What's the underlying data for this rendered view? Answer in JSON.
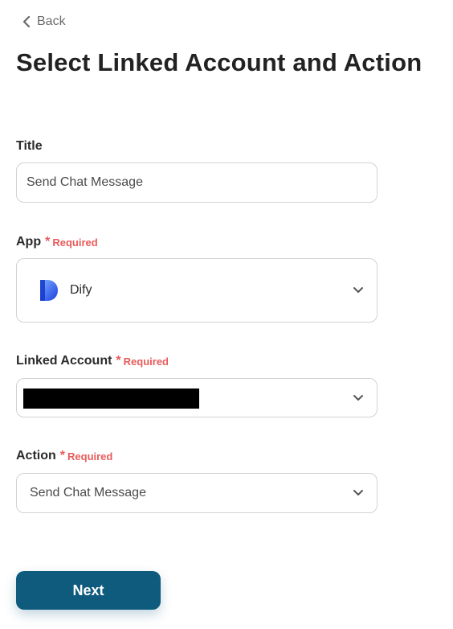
{
  "nav": {
    "back_label": "Back"
  },
  "page": {
    "title": "Select Linked Account and Action"
  },
  "title_field": {
    "label": "Title",
    "value": "Send Chat Message"
  },
  "app_field": {
    "label": "App",
    "required_mark": "*",
    "required_text": "Required",
    "selected_app": "Dify",
    "icon": "dify-logo-icon"
  },
  "linked_account_field": {
    "label": "Linked Account",
    "required_mark": "*",
    "required_text": "Required"
  },
  "action_field": {
    "label": "Action",
    "required_mark": "*",
    "required_text": "Required",
    "selected_action": "Send Chat Message"
  },
  "footer": {
    "next_label": "Next"
  },
  "colors": {
    "primary": "#0f5b7e",
    "required": "#e85b5b",
    "border": "#d2d2d2"
  }
}
